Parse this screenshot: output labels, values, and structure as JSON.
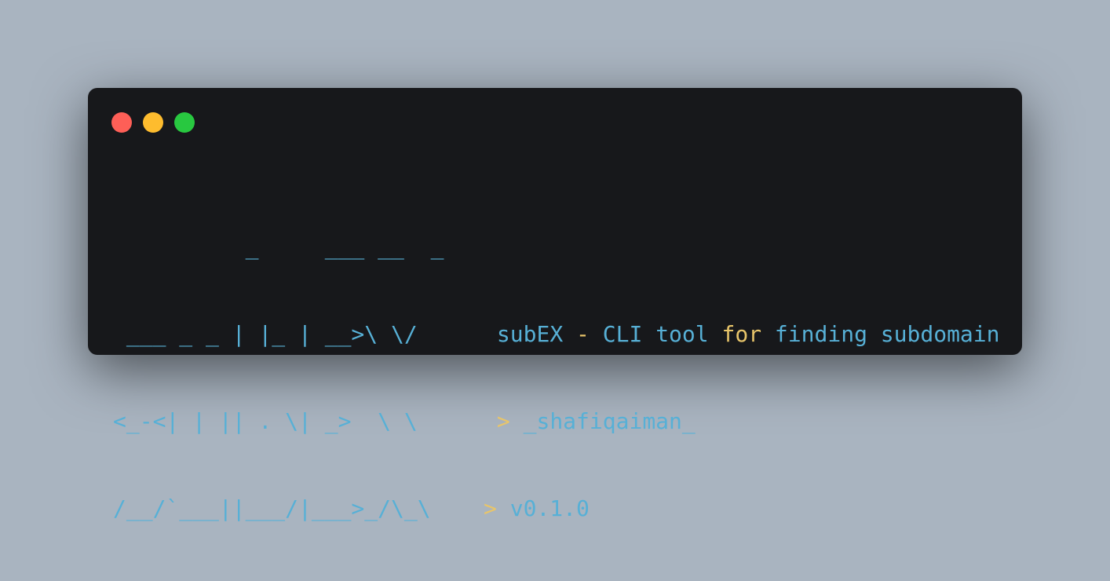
{
  "window_controls": {
    "close_color": "#fe5f57",
    "minimize_color": "#febc2e",
    "maximize_color": "#28c840"
  },
  "colors": {
    "background": "#a9b4c0",
    "terminal_background": "#17181b",
    "ascii": "#57b0d6",
    "text_primary": "#57b0d6",
    "text_accent": "#e8c56a"
  },
  "ascii_art": {
    "line1": "          _     ___ __  _",
    "line2": " ___ _ _ | |_ | __>\\ \\/",
    "line3": "<_-<| | || . \\| _>  \\ \\",
    "line4": "/__/`___||___/|___>_/\\_\\"
  },
  "info": {
    "name": "subEX",
    "dash": "-",
    "desc_part1": "CLI tool",
    "desc_for": "for",
    "desc_part2": "finding subdomain",
    "author_prompt": ">",
    "author": "_shafiqaiman_",
    "version_prompt": ">",
    "version": "v0.1.0"
  }
}
